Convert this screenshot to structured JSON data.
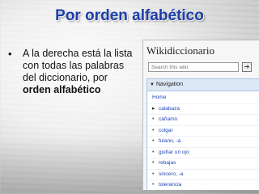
{
  "slide": {
    "title": "Por orden alfabético",
    "bullet_intro": "A la derecha está la lista con todas las palabras del diccionario, por ",
    "bullet_bold": "orden alfabético"
  },
  "wiki": {
    "site_name": "Wikidiccionario",
    "search_placeholder": "Search this wiki",
    "search_button_icon": "go-icon",
    "nav_heading": "Navigation",
    "nav_items": [
      {
        "label": "Home",
        "marker": "none"
      },
      {
        "label": "calabaza",
        "marker": "arrow"
      },
      {
        "label": "cáñamo",
        "marker": "dot"
      },
      {
        "label": "colgar",
        "marker": "dot"
      },
      {
        "label": "fulano, -a",
        "marker": "dot"
      },
      {
        "label": "guiñar un ojo",
        "marker": "dot"
      },
      {
        "label": "rebajas",
        "marker": "dot"
      },
      {
        "label": "sincero, -a",
        "marker": "dot"
      },
      {
        "label": "tolerancia",
        "marker": "dot"
      }
    ]
  }
}
